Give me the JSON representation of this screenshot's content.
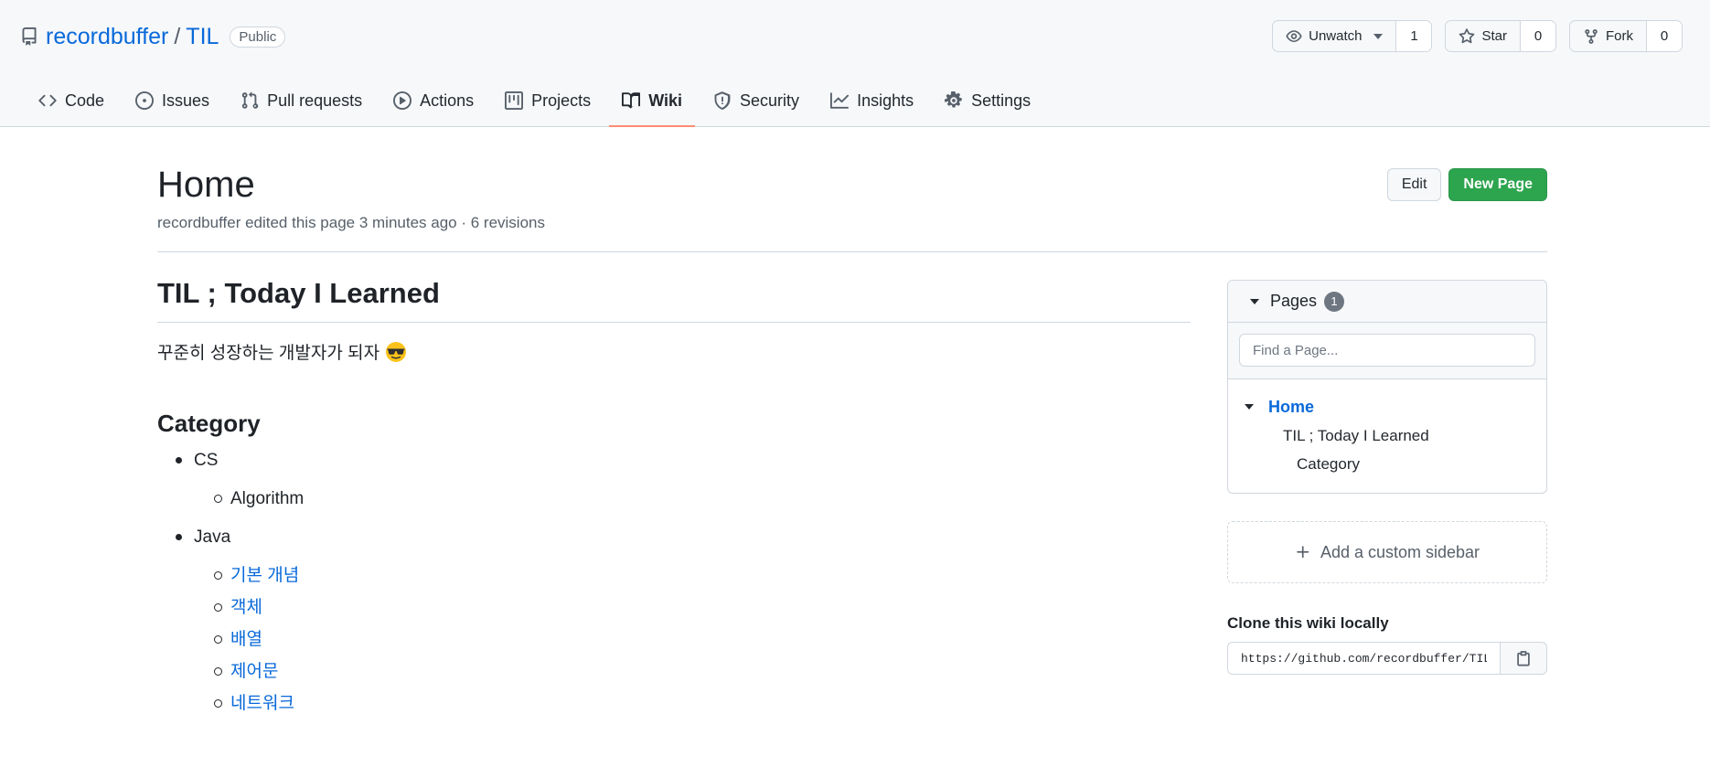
{
  "repo": {
    "owner": "recordbuffer",
    "separator": "/",
    "name": "TIL",
    "visibility": "Public",
    "watch": {
      "label": "Unwatch",
      "count": "1"
    },
    "star": {
      "label": "Star",
      "count": "0"
    },
    "fork": {
      "label": "Fork",
      "count": "0"
    }
  },
  "nav": {
    "code": "Code",
    "issues": "Issues",
    "pulls": "Pull requests",
    "actions": "Actions",
    "projects": "Projects",
    "wiki": "Wiki",
    "security": "Security",
    "insights": "Insights",
    "settings": "Settings",
    "active": "Wiki",
    "active_underline_color": "#fd8c73"
  },
  "wiki": {
    "title": "Home",
    "meta": "recordbuffer edited this page 3 minutes ago · 6 revisions",
    "edit_label": "Edit",
    "new_page_label": "New Page"
  },
  "content": {
    "heading": "TIL ; Today I Learned",
    "tagline": "꾸준히 성장하는 개발자가 되자",
    "tagline_emoji": "sunglasses-emoji",
    "category_heading": "Category",
    "categories": [
      {
        "name": "CS",
        "items": [
          "Algorithm"
        ]
      },
      {
        "name": "Java",
        "items": [
          "기본 개념",
          "객체",
          "배열",
          "제어문",
          "네트워크"
        ]
      }
    ]
  },
  "sidebar": {
    "pages_label": "Pages",
    "pages_count": "1",
    "search_placeholder": "Find a Page...",
    "home": "Home",
    "toc_1": "TIL ; Today I Learned",
    "toc_2": "Category",
    "custom_sidebar": "Add a custom sidebar",
    "clone_label": "Clone this wiki locally",
    "clone_url": "https://github.com/recordbuffer/TIL.wiki.git"
  },
  "colors": {
    "link": "#0969da",
    "primary_button": "#2da44e",
    "border": "#d0d7de"
  }
}
